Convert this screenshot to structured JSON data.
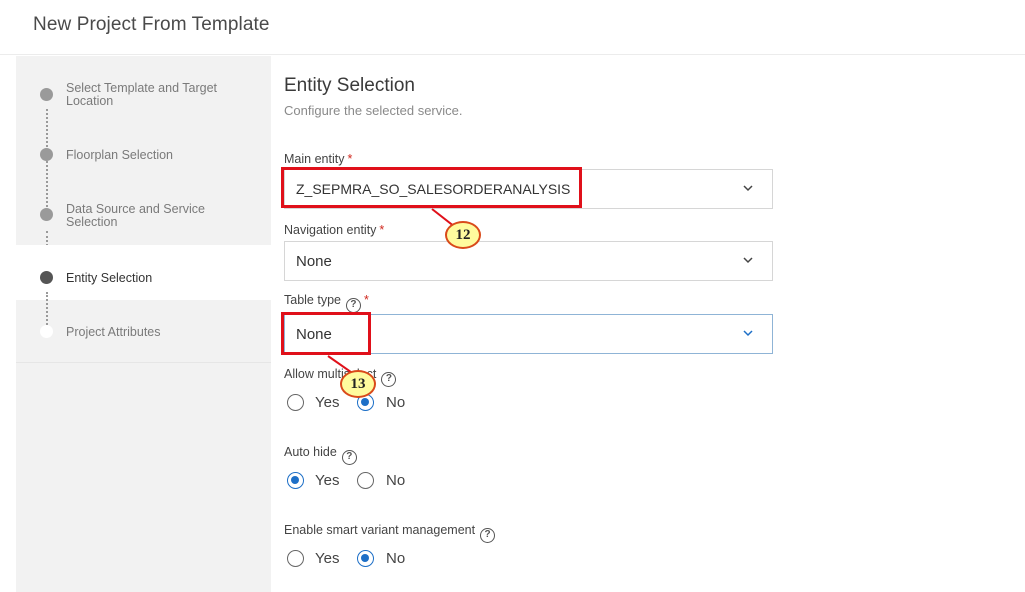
{
  "header": {
    "title": "New Project From Template"
  },
  "steps": [
    {
      "label": "Select Template and Target Location",
      "state": "done"
    },
    {
      "label": "Floorplan Selection",
      "state": "done"
    },
    {
      "label": "Data Source and Service Selection",
      "state": "done"
    },
    {
      "label": "Entity Selection",
      "state": "active"
    },
    {
      "label": "Project Attributes",
      "state": "future"
    }
  ],
  "main": {
    "title": "Entity Selection",
    "subtitle": "Configure the selected service.",
    "main_entity": {
      "label": "Main entity",
      "required": "*",
      "value": "Z_SEPMRA_SO_SALESORDERANALYSIS"
    },
    "navigation_entity": {
      "label": "Navigation entity",
      "required": "*",
      "value": "None"
    },
    "table_type": {
      "label": "Table type",
      "required": "*",
      "value": "None"
    },
    "allow_multiselect": {
      "label": "Allow multiselect",
      "yes": "Yes",
      "no": "No",
      "selected": "No"
    },
    "auto_hide": {
      "label": "Auto hide",
      "yes": "Yes",
      "no": "No",
      "selected": "Yes"
    },
    "smart_variant": {
      "label": "Enable smart variant management",
      "yes": "Yes",
      "no": "No",
      "selected": "No"
    }
  },
  "callouts": {
    "first": "12",
    "second": "13"
  },
  "icons": {
    "help": "question-circle-icon",
    "dropdown": "chevron-down-icon"
  },
  "colors": {
    "accent": "#1d6fc7",
    "required": "#d0271d",
    "callout_border": "#e0101a",
    "callout_fill": "#fffb9e"
  }
}
